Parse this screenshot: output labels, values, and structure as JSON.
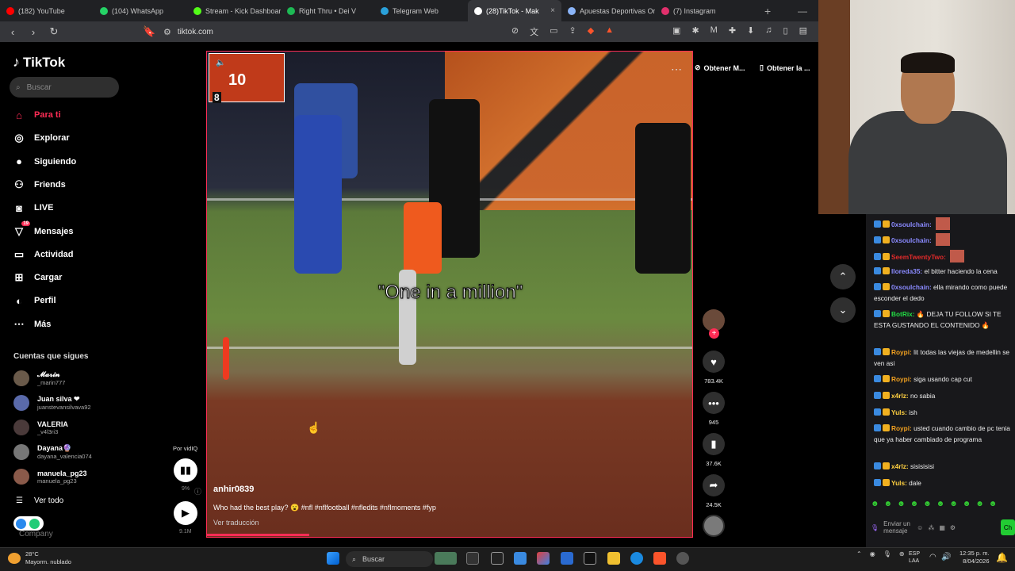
{
  "browser": {
    "tabs": [
      {
        "label": "(182) YouTube",
        "icon": "youtube-icon",
        "color": "#ff0000",
        "active": false
      },
      {
        "label": "(104) WhatsApp",
        "icon": "whatsapp-icon",
        "color": "#25d366",
        "active": false
      },
      {
        "label": "Stream - Kick Dashboar",
        "icon": "kick-icon",
        "color": "#53fc18",
        "active": false
      },
      {
        "label": "Right Thru • Dei V",
        "icon": "spotify-icon",
        "color": "#1db954",
        "active": false
      },
      {
        "label": "Telegram Web",
        "icon": "telegram-icon",
        "color": "#2aa1da",
        "active": false
      },
      {
        "label": "(28)TikTok - Mak",
        "icon": "tiktok-icon",
        "color": "#ffffff",
        "active": true
      },
      {
        "label": "Apuestas Deportivas Or",
        "icon": "s-icon",
        "color": "#8ab4f8",
        "active": false
      },
      {
        "label": "(7) Instagram",
        "icon": "instagram-icon",
        "color": "#e1306c",
        "active": false
      }
    ],
    "url": "tiktok.com"
  },
  "tiktok": {
    "logo": "TikTok",
    "search_placeholder": "Buscar",
    "nav": [
      {
        "label": "Para ti",
        "icon": "home-icon",
        "active": true
      },
      {
        "label": "Explorar",
        "icon": "compass-icon",
        "active": false
      },
      {
        "label": "Siguiendo",
        "icon": "following-icon",
        "active": false
      },
      {
        "label": "Friends",
        "icon": "friends-icon",
        "active": false
      },
      {
        "label": "LIVE",
        "icon": "live-icon",
        "active": false
      },
      {
        "label": "Mensajes",
        "icon": "messages-icon",
        "active": false,
        "badge": "19"
      },
      {
        "label": "Actividad",
        "icon": "activity-icon",
        "active": false
      },
      {
        "label": "Cargar",
        "icon": "upload-icon",
        "active": false
      },
      {
        "label": "Perfil",
        "icon": "profile-icon",
        "active": false
      },
      {
        "label": "Más",
        "icon": "more-icon",
        "active": false
      }
    ],
    "following_heading": "Cuentas que sigues",
    "following": [
      {
        "name": "𝓜𝓪𝓻𝓲𝓷",
        "handle": "_marin777"
      },
      {
        "name": "Juan silva ❤",
        "handle": "juanstevansilvava92"
      },
      {
        "name": "VALERIA",
        "handle": "_v4l3ri3"
      },
      {
        "name": "Dayana🔮",
        "handle": "dayana_valencia074"
      },
      {
        "name": "manuela_pg23",
        "handle": "manuela_pg23"
      }
    ],
    "see_all": "Ver todo",
    "company": "Company",
    "por_vidiq": "Por vidIQ",
    "vidiq_pct": "9%",
    "vidiq_views": "9.1M",
    "video": {
      "score_quarter": "10",
      "score_num": "8",
      "caption": "\"One in a million\"",
      "author": "anhir0839",
      "description": "Who had the best play? 😮 #nfl #nflfootball #nfledits #nflmoments #fyp",
      "translate": "Ver traducción",
      "progress": 0.21
    },
    "actions": {
      "likes": "783.4K",
      "comments": "945",
      "saves": "37.6K",
      "shares": "24.5K"
    },
    "extension": {
      "btn1": "Obtener M...",
      "btn2": "Obtener la ..."
    }
  },
  "chat": [
    {
      "user": "0xsoulchain:",
      "text": "",
      "color": "#8a8aff"
    },
    {
      "user": "0xsoulchain:",
      "text": "",
      "color": "#8a8aff"
    },
    {
      "user": "SeemTwentyTwo:",
      "text": "",
      "color": "#e02a2a"
    },
    {
      "user": "lloreda35:",
      "text": "el bitter haciendo la cena",
      "color": "#8a8aff"
    },
    {
      "user": "0xsoulchain:",
      "text": "ella mirando como puede esconder el dedo",
      "color": "#8a8aff"
    },
    {
      "user": "BotRix:",
      "text": "🔥 DEJA TU FOLLOW SI TE ESTA GUSTANDO EL CONTENIDO 🔥",
      "color": "#22dd44"
    },
    {
      "user": "Roypi:",
      "text": "lit todas las viejas de medellin se ven asi",
      "color": "#f0a020"
    },
    {
      "user": "Roypi:",
      "text": "siga usando cap cut",
      "color": "#f0a020"
    },
    {
      "user": "x4rlz:",
      "text": "no sabia",
      "color": "#ffd040"
    },
    {
      "user": "Yuls:",
      "text": "ish",
      "color": "#ffd040"
    },
    {
      "user": "Roypi:",
      "text": "usted cuando cambio de pc tenia que ya haber cambiado de programa",
      "color": "#f0a020"
    },
    {
      "user": "x4rlz:",
      "text": "sisisisisi",
      "color": "#ffd040"
    },
    {
      "user": "Yuls:",
      "text": "dale",
      "color": "#ffd040"
    }
  ],
  "chat_input": {
    "placeholder": "Enviar un mensaje",
    "send": "Ch"
  },
  "taskbar": {
    "weather_temp": "28°C",
    "weather_desc": "Mayorm. nublado",
    "search": "Buscar",
    "lang1": "ESP",
    "lang2": "LAA",
    "time": "12:35 p. m.",
    "date": "8/04/2026"
  }
}
